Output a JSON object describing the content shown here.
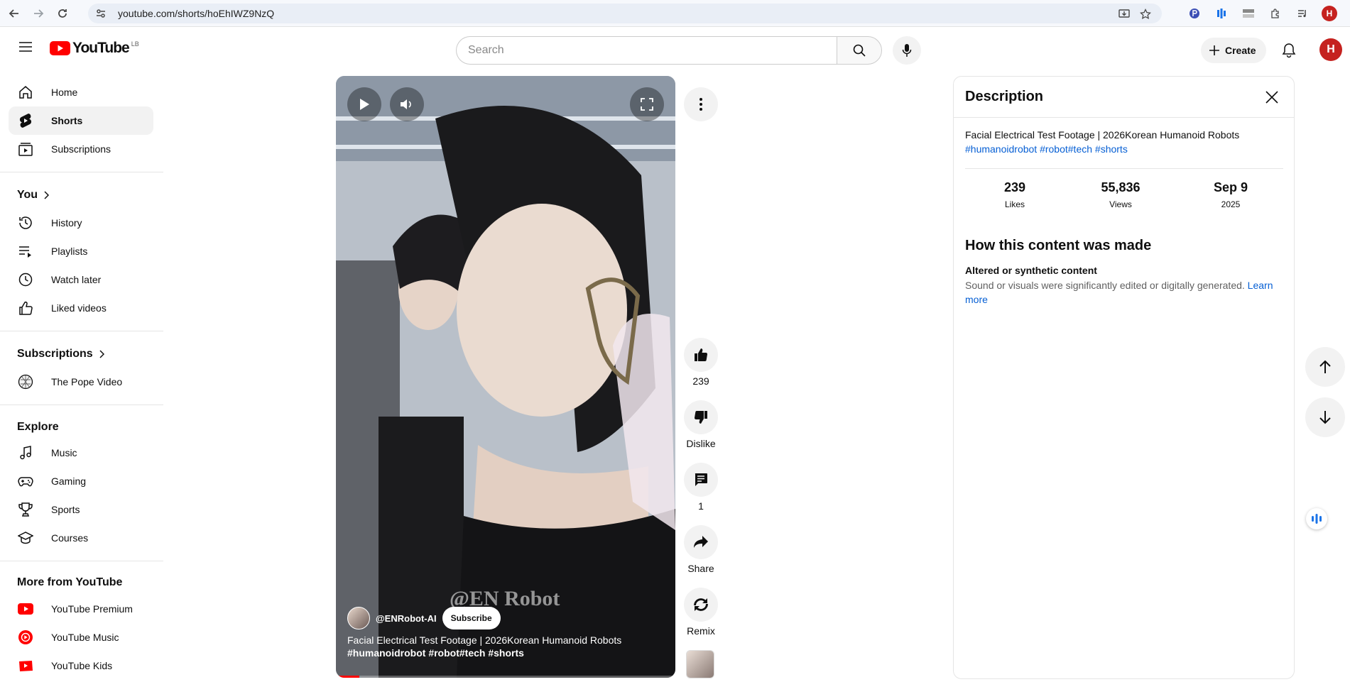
{
  "browser": {
    "url": "youtube.com/shorts/hoEhIWZ9NzQ",
    "profile_initial": "H"
  },
  "header": {
    "logo_text": "YouTube",
    "country_code": "LB",
    "search_placeholder": "Search",
    "create_label": "Create",
    "avatar_initial": "H"
  },
  "sidebar": {
    "main": [
      {
        "label": "Home",
        "icon": "home-icon"
      },
      {
        "label": "Shorts",
        "icon": "shorts-icon",
        "active": true
      },
      {
        "label": "Subscriptions",
        "icon": "subscriptions-icon"
      }
    ],
    "you_heading": "You",
    "you": [
      {
        "label": "History",
        "icon": "history-icon"
      },
      {
        "label": "Playlists",
        "icon": "playlists-icon"
      },
      {
        "label": "Watch later",
        "icon": "clock-icon"
      },
      {
        "label": "Liked videos",
        "icon": "thumbs-up-icon"
      }
    ],
    "subs_heading": "Subscriptions",
    "subs": [
      {
        "label": "The Pope Video",
        "icon": "channel-avatar"
      }
    ],
    "explore_heading": "Explore",
    "explore": [
      {
        "label": "Music",
        "icon": "music-note-icon"
      },
      {
        "label": "Gaming",
        "icon": "gamepad-icon"
      },
      {
        "label": "Sports",
        "icon": "trophy-icon"
      },
      {
        "label": "Courses",
        "icon": "graduation-cap-icon"
      }
    ],
    "more_heading": "More from YouTube",
    "more": [
      {
        "label": "YouTube Premium",
        "icon": "youtube-premium-icon"
      },
      {
        "label": "YouTube Music",
        "icon": "youtube-music-icon"
      },
      {
        "label": "YouTube Kids",
        "icon": "youtube-kids-icon"
      }
    ]
  },
  "video": {
    "watermark": "@EN Robot",
    "channel_handle": "@ENRobot-AI",
    "subscribe_label": "Subscribe",
    "title": "Facial Electrical Test Footage  | 2026Korean Humanoid Robots",
    "hashtags": "#humanoidrobot #robot#tech #shorts",
    "progress_fraction": 0.07
  },
  "actions": {
    "likes": "239",
    "dislike_label": "Dislike",
    "comments": "1",
    "share_label": "Share",
    "remix_label": "Remix"
  },
  "description": {
    "heading": "Description",
    "title": "Facial Electrical Test Footage | 2026Korean Humanoid Robots",
    "hashtags": "#humanoidrobot #robot#tech #shorts",
    "stats": [
      {
        "value": "239",
        "label": "Likes"
      },
      {
        "value": "55,836",
        "label": "Views"
      },
      {
        "value": "Sep 9",
        "label": "2025"
      }
    ],
    "how_heading": "How this content was made",
    "altered_title": "Altered or synthetic content",
    "altered_body": "Sound or visuals were significantly edited or digitally generated.",
    "learn_more": "Learn more"
  },
  "colors": {
    "brand_red": "#ff0000",
    "link_blue": "#065fd4",
    "chip_gray": "#f2f2f2"
  }
}
